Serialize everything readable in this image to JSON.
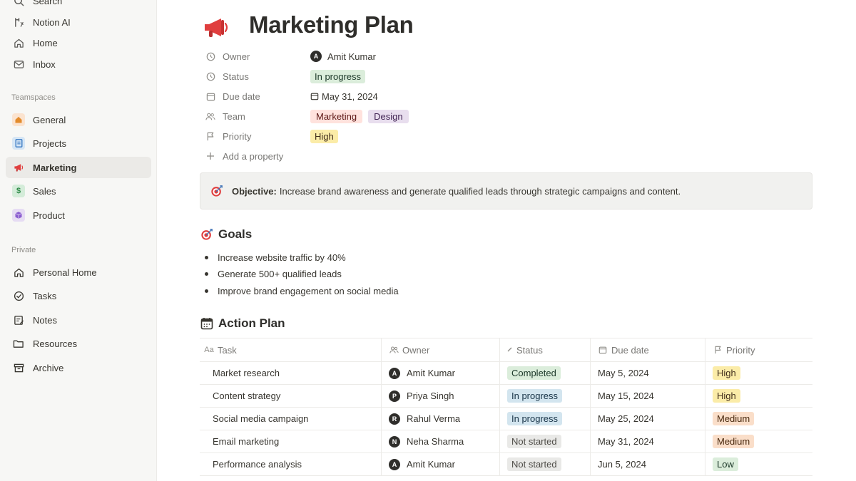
{
  "sidebar": {
    "top_items": [
      {
        "label": "Search",
        "icon": "search-icon"
      },
      {
        "label": "Notion AI",
        "icon": "notion-ai-icon"
      },
      {
        "label": "Home",
        "icon": "home-icon"
      },
      {
        "label": "Inbox",
        "icon": "inbox-icon"
      }
    ],
    "teamspaces_label": "Teamspaces",
    "teamspaces": [
      {
        "label": "General",
        "icon": "house-badge-icon"
      },
      {
        "label": "Projects",
        "icon": "document-badge-icon"
      },
      {
        "label": "Marketing",
        "icon": "megaphone-icon",
        "active": true
      },
      {
        "label": "Sales",
        "icon": "dollar-badge-icon",
        "glyph": "$"
      },
      {
        "label": "Product",
        "icon": "cube-badge-icon"
      }
    ],
    "private_label": "Private",
    "private": [
      {
        "label": "Personal Home",
        "icon": "home-icon"
      },
      {
        "label": "Tasks",
        "icon": "check-circle-icon"
      },
      {
        "label": "Notes",
        "icon": "notes-icon"
      },
      {
        "label": "Resources",
        "icon": "folder-icon"
      },
      {
        "label": "Archive",
        "icon": "archive-icon"
      }
    ]
  },
  "page": {
    "title": "Marketing Plan",
    "icon": "megaphone-icon",
    "properties": {
      "owner": {
        "label": "Owner",
        "value": "Amit Kumar",
        "avatar": "A"
      },
      "status": {
        "label": "Status",
        "value": "In progress"
      },
      "due_date": {
        "label": "Due date",
        "value": "May 31, 2024"
      },
      "team": {
        "label": "Team",
        "tags": [
          "Marketing",
          "Design"
        ]
      },
      "priority": {
        "label": "Priority",
        "value": "High"
      },
      "add": {
        "label": "Add a property"
      }
    },
    "callout": {
      "label": "Objective:",
      "text": "Increase brand awareness and generate qualified leads through strategic campaigns and content."
    },
    "goals": {
      "heading": "Goals",
      "items": [
        "Increase website traffic by 40%",
        "Generate 500+ qualified leads",
        "Improve brand engagement on social media"
      ]
    },
    "action_plan": {
      "heading": "Action Plan",
      "columns": {
        "task": "Task",
        "owner": "Owner",
        "status": "Status",
        "due": "Due date",
        "priority": "Priority"
      },
      "column_icon_task": "Aa",
      "rows": [
        {
          "task": "Market research",
          "owner": "Amit Kumar",
          "avatar": "A",
          "status": "Completed",
          "due": "May 5, 2024",
          "priority": "High"
        },
        {
          "task": "Content strategy",
          "owner": "Priya Singh",
          "avatar": "P",
          "status": "In progress",
          "due": "May 15, 2024",
          "priority": "High"
        },
        {
          "task": "Social media campaign",
          "owner": "Rahul Verma",
          "avatar": "R",
          "status": "In progress",
          "due": "May 25, 2024",
          "priority": "Medium"
        },
        {
          "task": "Email marketing",
          "owner": "Neha Sharma",
          "avatar": "N",
          "status": "Not started",
          "due": "May 31, 2024",
          "priority": "Medium"
        },
        {
          "task": "Performance analysis",
          "owner": "Amit Kumar",
          "avatar": "A",
          "status": "Not started",
          "due": "Jun 5, 2024",
          "priority": "Low"
        }
      ]
    }
  },
  "colors": {
    "status_completed": "#dbeddb",
    "status_completed_text": "#1c3829",
    "status_in_progress": "#d3e5ef",
    "status_in_progress_text": "#183347",
    "status_not_started": "#e9e9e7",
    "status_not_started_text": "#4f4d48",
    "priority_high": "#fbeca8",
    "priority_high_text": "#402c1b",
    "priority_medium": "#fadec9",
    "priority_medium_text": "#49290e",
    "priority_low": "#dbeddb",
    "priority_low_text": "#1c3829",
    "tag_marketing": "#ffe2dd",
    "tag_design": "#e8deee",
    "accent_red": "#e03e3e"
  }
}
